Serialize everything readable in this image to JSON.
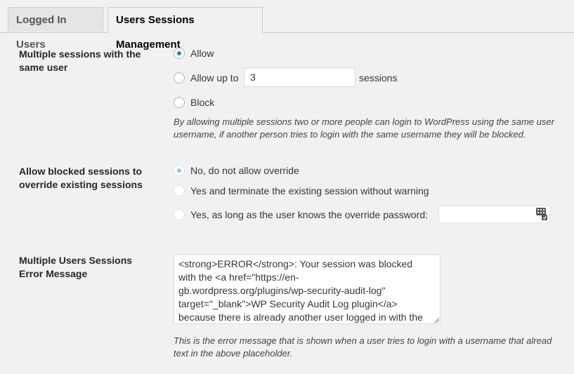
{
  "tabs": {
    "logged_in_users": "Logged In Users",
    "sessions_management": "Users Sessions Management"
  },
  "multiple_sessions": {
    "label_line1": "Multiple sessions with the",
    "label_line2": "same user",
    "option_allow": "Allow",
    "option_allow_up_to_prefix": "Allow up to",
    "allow_up_to_value": "3",
    "option_allow_up_to_suffix": "sessions",
    "option_block": "Block",
    "selected": "Allow",
    "description_line1": "By allowing multiple sessions two or more people can login to WordPress using the same user",
    "description_line2": "username, if another person tries to login with the same username they will be blocked."
  },
  "override": {
    "label_line1": "Allow blocked sessions to",
    "label_line2": "override existing sessions",
    "option_no": "No, do not allow override",
    "option_terminate": "Yes and terminate the existing session without warning",
    "option_password": "Yes, as long as the user knows the override password:",
    "password_value": "",
    "selected": "No, do not allow override"
  },
  "error_message": {
    "label_line1": "Multiple Users Sessions",
    "label_line2": "Error Message",
    "textarea_lines": [
      "<strong>ERROR</strong>: Your session was blocked",
      "with the <a href=\"https://en-",
      "gb.wordpress.org/plugins/wp-security-audit-log\"",
      "target=\"_blank\">WP Security Audit Log plugin</a>",
      "because there is already another user logged in with the"
    ],
    "description_line1": "This is the error message that is shown when a user tries to login with a username that alread",
    "description_line2": "text in the above placeholder."
  },
  "icons": {
    "keyboard": "keyboard-icon"
  },
  "colors": {
    "accent": "#1e8cbe",
    "background": "#f1f1f1"
  }
}
